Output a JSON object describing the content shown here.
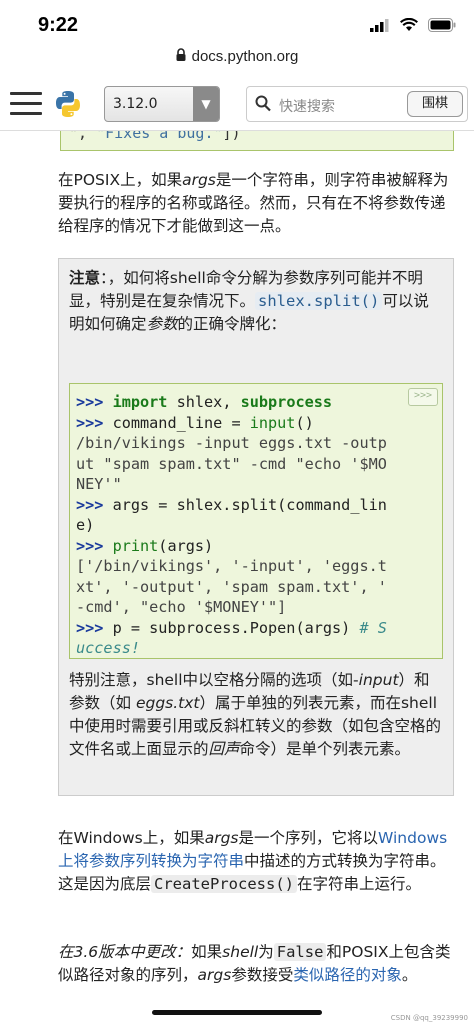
{
  "status": {
    "time": "9:22"
  },
  "browser": {
    "url": "docs.python.org"
  },
  "toolbar": {
    "version": "3.12.0",
    "search_placeholder": "快速搜索",
    "search_button": "围棋"
  },
  "code_top": {
    "prefix": "\", ",
    "string": "\"Fixes a bug.\"",
    "suffix": "])"
  },
  "para1": {
    "a": "在POSIX上，如果",
    "args_em": "args",
    "b": "是一个字符串，则字符串被解释为要执行的程序的名称或路径。然而，只有在不将参数传递给程序的情况下才能做到这一点。"
  },
  "note": {
    "label": "注意",
    "text1": "：，如何将shell命令分解为参数序列可能并不明显，特别是在复杂情况下。",
    "code": "shlex.split()",
    "text2": "可以说明如何确定",
    "em": "参数",
    "text3": "的正确令牌化：",
    "copy_label": ">>>",
    "code_lines": {
      "l1_prompt": ">>> ",
      "l1_kw": "import",
      "l1_rest": " shlex, ",
      "l1_mod": "subprocess",
      "l2_prompt": ">>> ",
      "l2_a": "command_line = ",
      "l2_fn": "input",
      "l2_b": "()",
      "l3": "/bin/vikings -input eggs.txt -outp",
      "l4": "ut \"spam spam.txt\" -cmd \"echo '$MO",
      "l5": "NEY'\"",
      "l6_prompt": ">>> ",
      "l6_a": "args = shlex.split(command_lin",
      "l7": "e)",
      "l8_prompt": ">>> ",
      "l8_fn": "print",
      "l8_b": "(args)",
      "l9": "['/bin/vikings', '-input', 'eggs.t",
      "l10": "xt', '-output', 'spam spam.txt', '",
      "l11": "-cmd', \"echo '$MONEY'\"]",
      "l12_prompt": ">>> ",
      "l12_a": "p = subprocess.Popen(args) ",
      "l12_cmt": "# S",
      "l13_cmt": "uccess!"
    },
    "after_a": "特别注意，shell中以空格分隔的选项（如-",
    "after_em1": "input",
    "after_b": "）和参数（如 ",
    "after_em2": "eggs.txt",
    "after_c": "）属于单独的列表元素，而在shell中使用时需要引用或反斜杠转义的参数（如包含空格的文件名或上面显示的",
    "after_em3": "回声",
    "after_d": "命令）是单个列表元素。"
  },
  "para2": {
    "a": "在Windows上，如果",
    "args_em": "args",
    "b": "是一个序列，它将以",
    "link": "Windows上将参数序列转换为字符串",
    "c": "中描述的方式转换为字符串。这是因为底层",
    "code": "CreateProcess()",
    "d": "在字符串上运行。"
  },
  "para3": {
    "em1": "在3.6版本中更改：",
    "a": "如果",
    "em2": "shell",
    "b": "为",
    "code": "False",
    "c": "和POSIX上包含类似路径对象的序列，",
    "args_em": "args",
    "d": "参数接受",
    "link": "类似路径的对象",
    "e": "。"
  },
  "watermark": "CSDN @qq_39239990"
}
